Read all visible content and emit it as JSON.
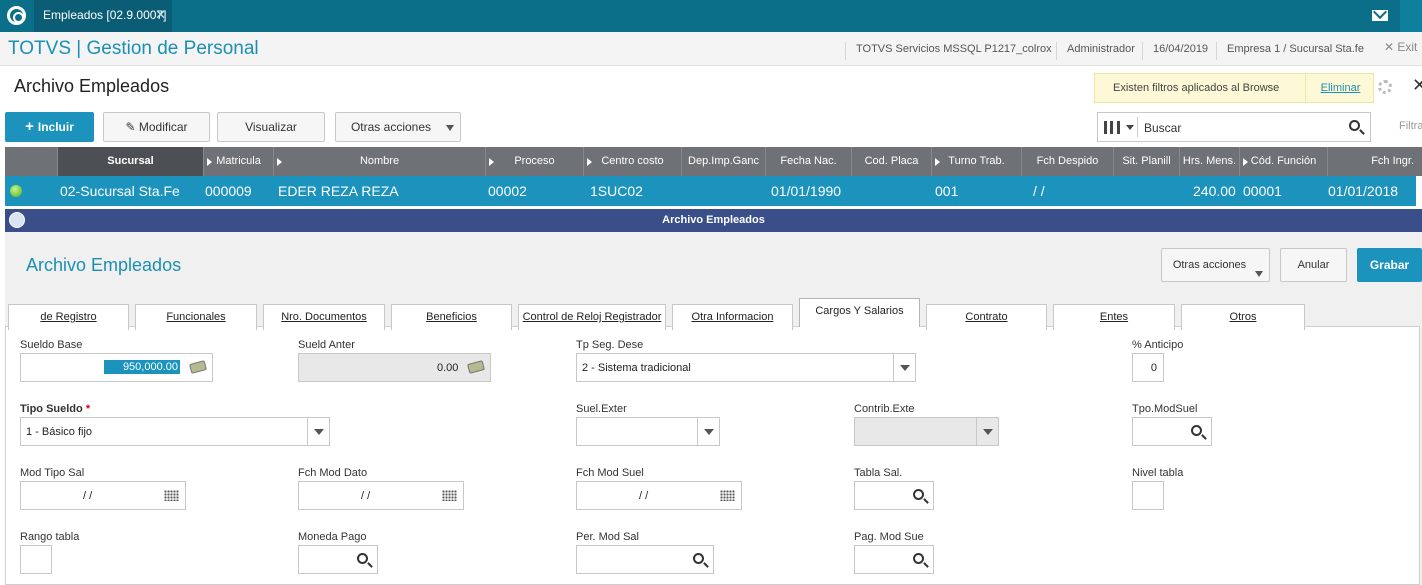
{
  "topbar": {
    "tab_label": "Empleados [02.9.0007]",
    "tab_close": "✕"
  },
  "header": {
    "app_title": "TOTVS | Gestion de Personal",
    "server": "TOTVS Servicios MSSQL P1217_colrox",
    "user": "Administrador",
    "date": "16/04/2019",
    "company": "Empresa 1 / Sucursal Sta.fe",
    "exit": "✕  Exit"
  },
  "browse": {
    "title": "Archivo Empleados",
    "filter_banner": "Existen filtros aplicados al Browse",
    "filter_remove": "Eliminar",
    "buttons": {
      "include": "Incluir",
      "modify": "Modificar",
      "view": "Visualizar",
      "other": "Otras acciones"
    },
    "search_placeholder": "Buscar",
    "filter_label": "Filtra",
    "columns": [
      "Sucursal",
      "Matricula",
      "Nombre",
      "Proceso",
      "Centro costo",
      "Dep.Imp.Ganc",
      "Fecha Nac.",
      "Cod. Placa",
      "Turno Trab.",
      "Fch Despido",
      "Sit. Planill",
      "Hrs. Mens.",
      "Cód. Función",
      "Fch Ingr."
    ],
    "row": {
      "sucursal": "02-Sucursal Sta.Fe",
      "matricula": "000009",
      "nombre": "EDER  REZA REZA",
      "proceso": "00002",
      "centro_costo": "1SUC02",
      "fecha_nac": "01/01/1990",
      "turno": "001",
      "fch_despido": "/  /",
      "hrs_mens": "240.00",
      "cod_funcion": "00001",
      "fch_ingr": "01/01/2018"
    }
  },
  "dialog": {
    "window_title": "Archivo Empleados",
    "heading": "Archivo Empleados",
    "buttons": {
      "other": "Otras acciones",
      "cancel": "Anular",
      "save": "Grabar"
    },
    "tabs": [
      "de Registro",
      "Funcionales",
      "Nro. Documentos",
      "Beneficios",
      "Control de Reloj Registrador",
      "Otra Informacion",
      "Cargos Y Salarios",
      "Contrato",
      "Entes",
      "Otros"
    ],
    "active_tab": "Cargos Y Salarios",
    "fields": {
      "sueldo_base": {
        "label": "Sueldo Base",
        "value": "950,000.00"
      },
      "sueld_anter": {
        "label": "Sueld Anter",
        "value": "0.00"
      },
      "tp_seg": {
        "label": "Tp Seg. Dese",
        "value": "2 - Sistema tradicional"
      },
      "anticipo": {
        "label": "% Anticipo",
        "value": "0"
      },
      "tipo_sueldo": {
        "label": "Tipo Sueldo",
        "value": "1 - Básico fijo",
        "required": "*"
      },
      "suel_exter": {
        "label": "Suel.Exter",
        "value": ""
      },
      "contrib_exte": {
        "label": "Contrib.Exte",
        "value": ""
      },
      "tpo_modsuel": {
        "label": "Tpo.ModSuel",
        "value": ""
      },
      "mod_tipo_sal": {
        "label": "Mod Tipo Sal",
        "value": "/  /"
      },
      "fch_mod_dato": {
        "label": "Fch Mod Dato",
        "value": "/  /"
      },
      "fch_mod_suel": {
        "label": "Fch Mod Suel",
        "value": "/  /"
      },
      "tabla_sal": {
        "label": "Tabla Sal.",
        "value": ""
      },
      "nivel_tabla": {
        "label": "Nivel tabla",
        "value": ""
      },
      "rango_tabla": {
        "label": "Rango tabla",
        "value": ""
      },
      "moneda_pago": {
        "label": "Moneda Pago",
        "value": ""
      },
      "per_mod_sal": {
        "label": "Per. Mod Sal",
        "value": ""
      },
      "pag_mod_sue": {
        "label": "Pag. Mod Sue",
        "value": ""
      }
    }
  },
  "colors": {
    "brand": "#0c6f8a",
    "accent": "#1b93bd",
    "grid_header": "#6e7175",
    "dialog_title": "#3a4f8a"
  },
  "icons": [
    "app-logo-icon",
    "mail-icon",
    "gear-icon",
    "search-icon",
    "columns-icon",
    "calendar-icon",
    "money-icon",
    "status-dot-icon"
  ]
}
